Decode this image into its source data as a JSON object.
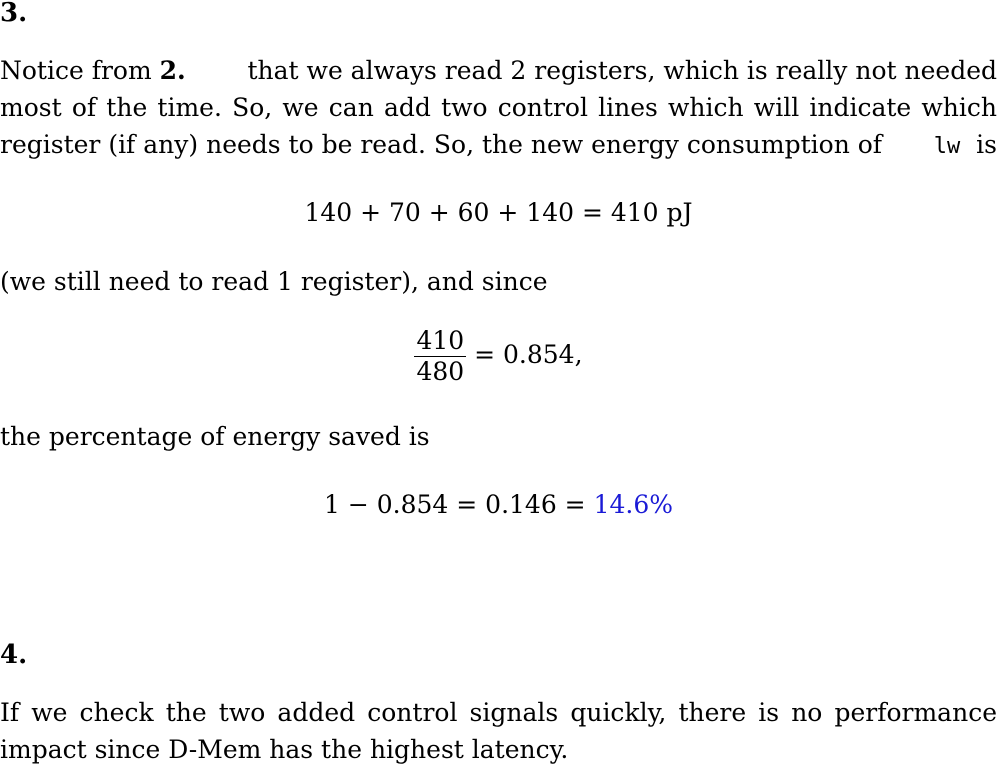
{
  "section3": {
    "heading": "3.",
    "para1": {
      "line1_a": "Notice from",
      "line1_bold": "2.",
      "line1_b": "that we always read 2 registers, which is really not needed",
      "line2": "most of the time. So, we can add two control lines which will indicate which",
      "line3_a": "register (if any) needs to be read. So, the new energy consumption of",
      "line3_code": "lw",
      "line3_b": "is"
    },
    "eq1": "140 + 70 + 60 + 140 = 410 pJ",
    "para2": "(we still need to read 1 register), and since",
    "eq2": {
      "numerator": "410",
      "denominator": "480",
      "rest": "= 0.854,"
    },
    "para3": "the percentage of energy saved is",
    "eq3": {
      "main": "1 − 0.854 = 0.146 =",
      "highlight": "14.6%"
    }
  },
  "section4": {
    "heading": "4.",
    "line1": "If we check the two added control signals quickly, there is no performance",
    "line2": "impact since D-Mem has the highest latency."
  },
  "colors": {
    "highlight": "#1a1ad6"
  }
}
